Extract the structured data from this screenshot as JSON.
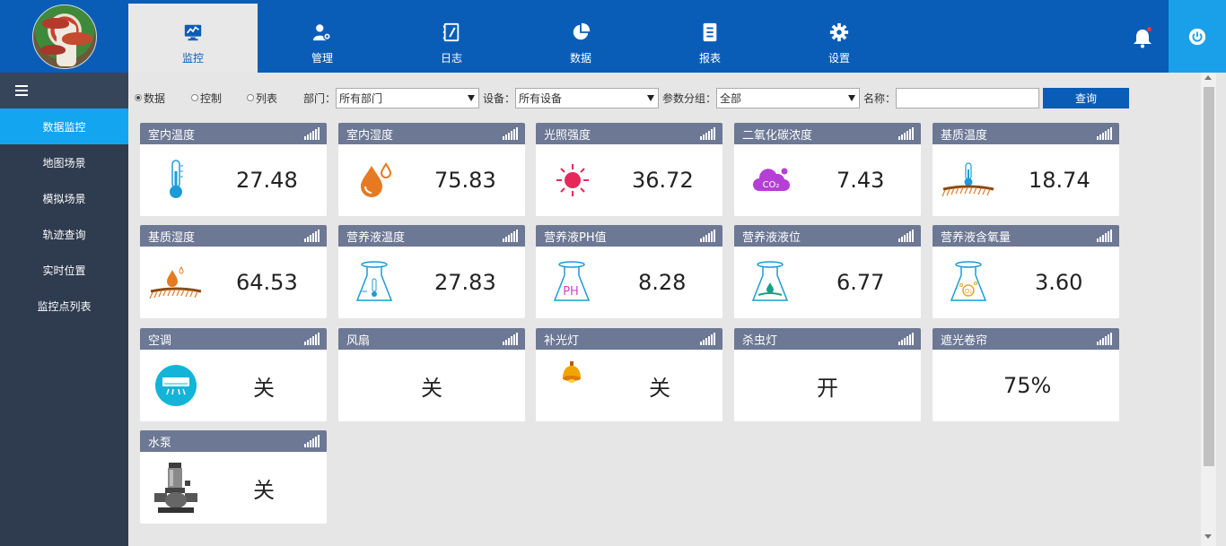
{
  "header": {
    "tabs": [
      {
        "label": "监控",
        "icon": "monitor-chart-icon",
        "active": true
      },
      {
        "label": "管理",
        "icon": "user-gear-icon",
        "active": false
      },
      {
        "label": "日志",
        "icon": "notebook-pen-icon",
        "active": false
      },
      {
        "label": "数据",
        "icon": "pie-chart-icon",
        "active": false
      },
      {
        "label": "报表",
        "icon": "document-list-icon",
        "active": false
      },
      {
        "label": "设置",
        "icon": "gear-icon",
        "active": false
      }
    ],
    "bell_icon": "bell-icon",
    "power_icon": "power-icon"
  },
  "sidebar": {
    "toggle_icon": "hamburger-menu-icon",
    "items": [
      {
        "label": "数据监控",
        "active": true
      },
      {
        "label": "地图场景",
        "active": false
      },
      {
        "label": "模拟场景",
        "active": false
      },
      {
        "label": "轨迹查询",
        "active": false
      },
      {
        "label": "实时位置",
        "active": false
      },
      {
        "label": "监控点列表",
        "active": false
      }
    ]
  },
  "filters": {
    "view_options": [
      {
        "label": "数据",
        "checked": true
      },
      {
        "label": "控制",
        "checked": false
      },
      {
        "label": "列表",
        "checked": false
      }
    ],
    "department_label": "部门：",
    "department_value": "所有部门",
    "device_label": "设备：",
    "device_value": "所有设备",
    "param_group_label": "参数分组：",
    "param_group_value": "全部",
    "name_label": "名称：",
    "name_value": "",
    "query_button": "查询"
  },
  "cards": [
    {
      "title": "室内温度",
      "value": "27.48",
      "icon": "thermometer-icon"
    },
    {
      "title": "室内湿度",
      "value": "75.83",
      "icon": "water-drop-icon"
    },
    {
      "title": "光照强度",
      "value": "36.72",
      "icon": "sun-icon"
    },
    {
      "title": "二氧化碳浓度",
      "value": "7.43",
      "icon": "co2-cloud-icon"
    },
    {
      "title": "基质温度",
      "value": "18.74",
      "icon": "soil-thermometer-icon"
    },
    {
      "title": "基质湿度",
      "value": "64.53",
      "icon": "soil-drop-icon"
    },
    {
      "title": "营养液温度",
      "value": "27.83",
      "icon": "flask-thermometer-icon"
    },
    {
      "title": "营养液PH值",
      "value": "8.28",
      "icon": "flask-ph-icon"
    },
    {
      "title": "营养液液位",
      "value": "6.77",
      "icon": "flask-level-icon"
    },
    {
      "title": "营养液含氧量",
      "value": "3.60",
      "icon": "flask-oxygen-icon"
    },
    {
      "title": "空调",
      "value": "关",
      "icon": "air-conditioner-icon"
    },
    {
      "title": "风扇",
      "value": "关",
      "icon": ""
    },
    {
      "title": "补光灯",
      "value": "关",
      "icon": "lamp-icon"
    },
    {
      "title": "杀虫灯",
      "value": "开",
      "icon": ""
    },
    {
      "title": "遮光卷帘",
      "value": "75%",
      "icon": ""
    },
    {
      "title": "水泵",
      "value": "关",
      "icon": "water-pump-icon"
    }
  ],
  "colors": {
    "header_bg": "#0a5db7",
    "sidebar_bg": "#2f3b4e",
    "sidebar_active": "#13a5ef",
    "card_header": "#6c7894",
    "power_bg": "#1aa0e8"
  }
}
